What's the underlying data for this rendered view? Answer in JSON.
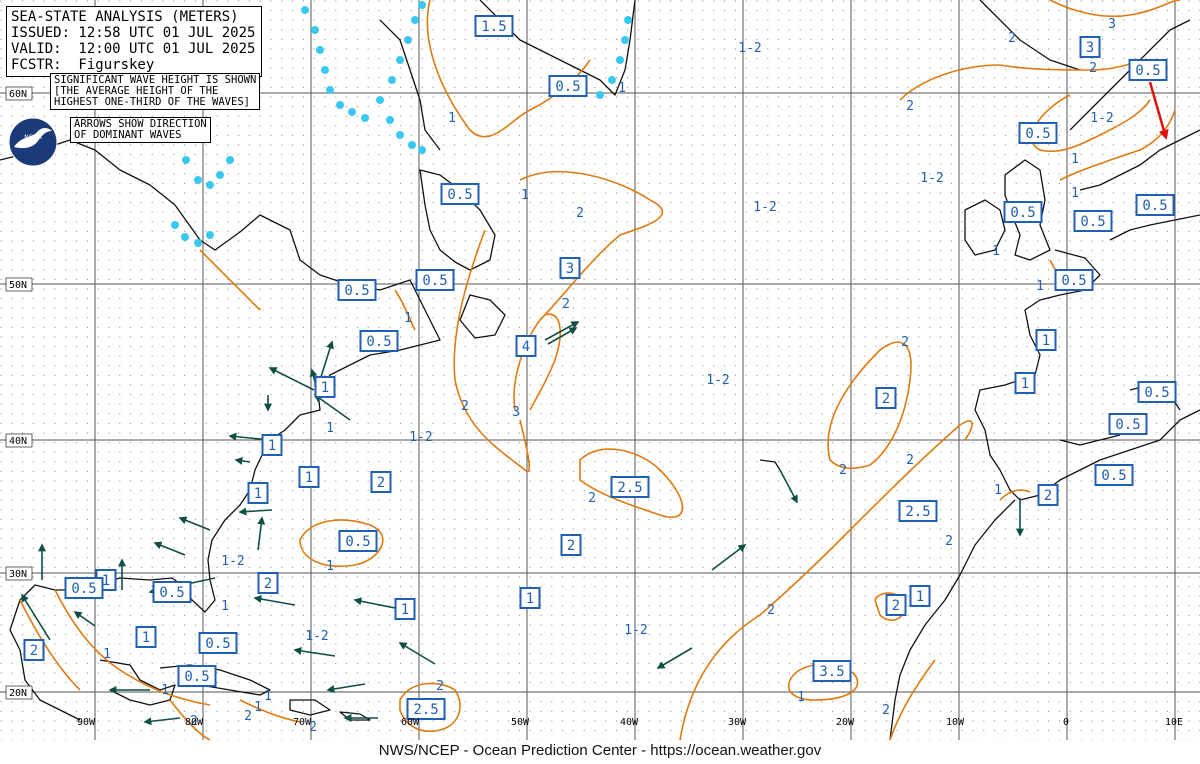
{
  "header": {
    "line1": "SEA-STATE ANALYSIS (METERS)",
    "line2": "ISSUED: 12:58 UTC 01 JUL 2025",
    "line3": "VALID:  12:00 UTC 01 JUL 2025",
    "line4": "FCSTR:  Figurskey"
  },
  "notes": {
    "wave_height": [
      "SIGNIFICANT WAVE HEIGHT IS SHOWN",
      "[THE AVERAGE HEIGHT OF THE",
      "HIGHEST ONE-THIRD OF THE WAVES]"
    ],
    "arrows": [
      "ARROWS SHOW DIRECTION",
      "OF DOMINANT WAVES"
    ]
  },
  "logo": {
    "icon": "noaa-logo",
    "text": "NOAA"
  },
  "footer": "NWS/NCEP - Ocean Prediction Center - https://ocean.weather.gov",
  "colors": {
    "contour": "#e07a10",
    "box": "#1f5fb4",
    "arrow": "#0e4f45",
    "red_arrow": "#e01010",
    "ice": "#3bc8ee",
    "land": "#111111",
    "grid": "#555555"
  },
  "lat_labels": [
    "60N",
    "50N",
    "40N",
    "30N",
    "20N"
  ],
  "lon_labels": [
    "90W",
    "80W",
    "70W",
    "60W",
    "50W",
    "40W",
    "30W",
    "20W",
    "10W",
    "0",
    "10E"
  ],
  "boxed_values": [
    "1.5",
    "0.5",
    "3",
    "0.5",
    "0.5",
    "0.5",
    "0.5",
    "0.5",
    "0.5",
    "0.5",
    "0.5",
    "0.5",
    "3",
    "4",
    "0.5",
    "1",
    "1",
    "1",
    "1",
    "2",
    "2",
    "2.5",
    "2.5",
    "0.5",
    "2",
    "1",
    "1",
    "0.5",
    "1",
    "1",
    "0.5",
    "2",
    "1",
    "2",
    "2",
    "0.5",
    "2.5",
    "1",
    "0.5",
    "0.5",
    "0.5",
    "0.5",
    "3.5",
    "2",
    "1"
  ],
  "contour_labels": [
    "1",
    "1",
    "1",
    "2",
    "3",
    "1-2",
    "2",
    "3",
    "2",
    "1-2",
    "1-2",
    "1",
    "1-2",
    "2",
    "1-2",
    "2",
    "1",
    "1-2",
    "1-2",
    "2",
    "2",
    "2",
    "2",
    "1",
    "1-2",
    "1",
    "2",
    "1",
    "1",
    "1",
    "2",
    "2",
    "1",
    "1",
    "2",
    "1-2",
    "3",
    "2",
    "1",
    "1",
    "2",
    "1",
    "2",
    "2",
    "1",
    "1"
  ]
}
